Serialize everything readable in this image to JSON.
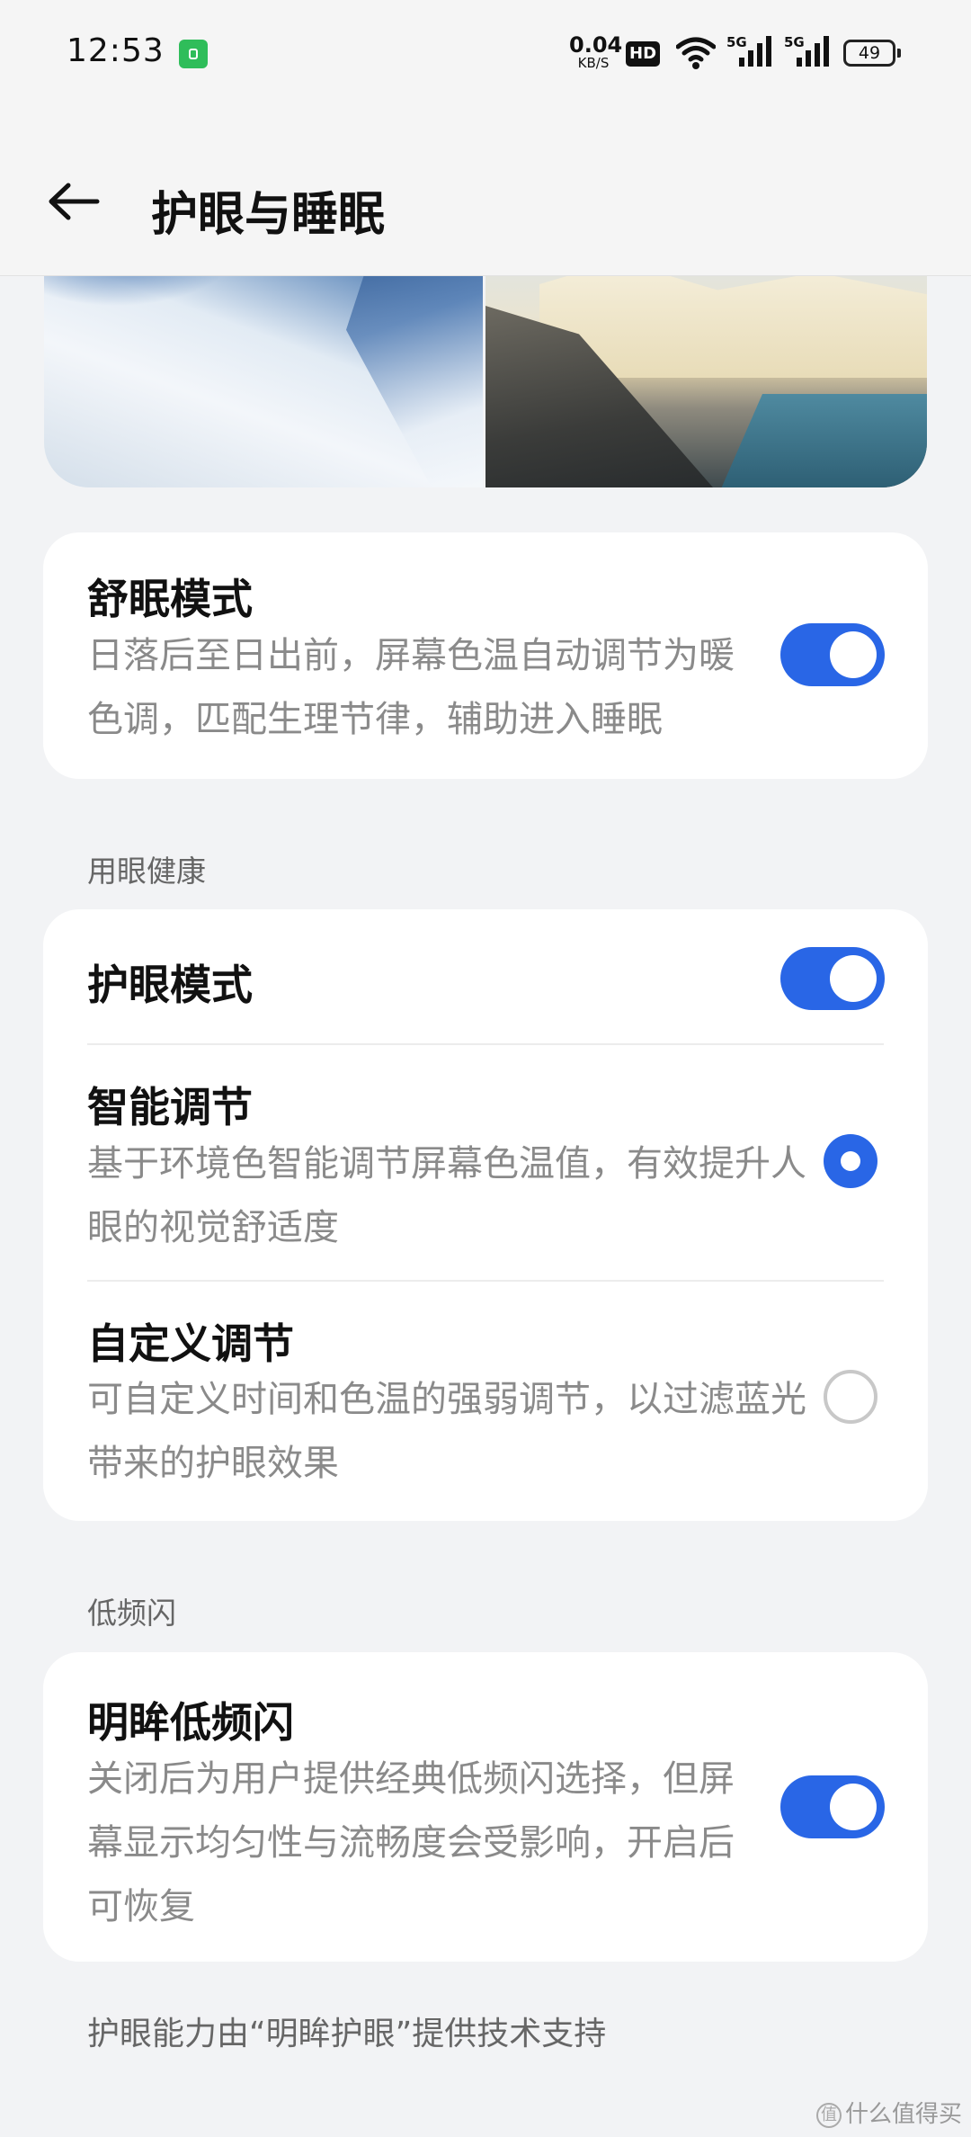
{
  "status_bar": {
    "time": "12:53",
    "net_speed_value": "0.04",
    "net_speed_unit": "KB/S",
    "hd_badge": "HD",
    "signal1_label": "5G",
    "signal2_label": "5G",
    "battery_level": "49"
  },
  "header": {
    "title": "护眼与睡眠"
  },
  "sleep_card": {
    "title": "舒眠模式",
    "description": "日落后至日出前，屏幕色温自动调节为暖色调，匹配生理节律，辅助进入睡眠",
    "toggle_on": true
  },
  "eye_health_section": {
    "header": "用眼健康",
    "eye_mode_title": "护眼模式",
    "eye_mode_toggle_on": true,
    "options": [
      {
        "title": "智能调节",
        "description": "基于环境色智能调节屏幕色温值，有效提升人眼的视觉舒适度",
        "selected": true
      },
      {
        "title": "自定义调节",
        "description": "可自定义时间和色温的强弱调节，以过滤蓝光带来的护眼效果",
        "selected": false
      }
    ]
  },
  "flicker_section": {
    "header": "低频闪",
    "title": "明眸低频闪",
    "description": "关闭后为用户提供经典低频闪选择，但屏幕显示均匀性与流畅度会受影响，开启后可恢复",
    "toggle_on": true
  },
  "footer_note": "护眼能力由“明眸护眼”提供技术支持",
  "watermark": "什么值得买",
  "watermark_logo": "值",
  "colors": {
    "accent": "#2966e6",
    "background": "#f2f3f5",
    "card": "#ffffff",
    "secondary_text": "#8a8a8a"
  }
}
